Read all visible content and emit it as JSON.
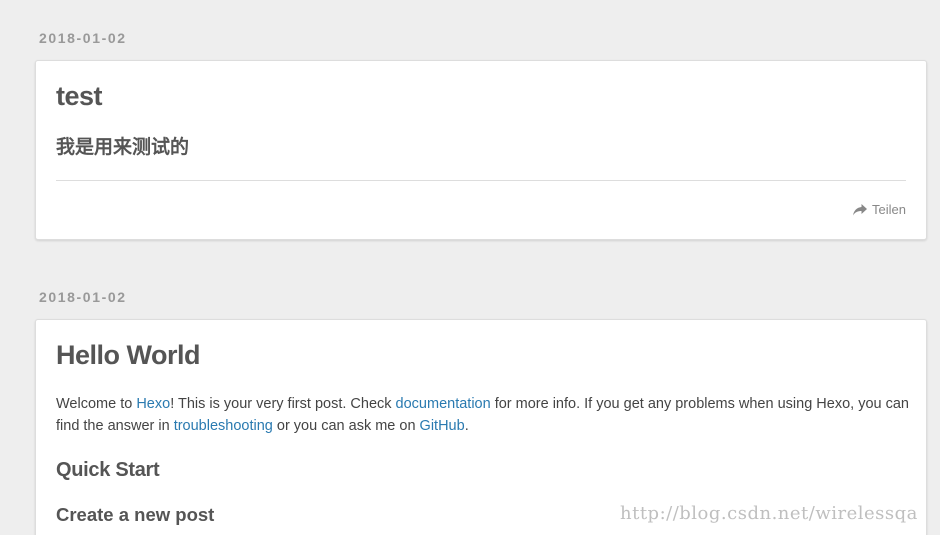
{
  "posts": [
    {
      "date": "2018-01-02",
      "title": "test",
      "subtitle": "我是用来测试的",
      "share_label": "Teilen"
    },
    {
      "date": "2018-01-02",
      "title": "Hello World",
      "body": {
        "t1": "Welcome to ",
        "link_hexo": "Hexo",
        "t2": "! This is your very first post. Check ",
        "link_docs": "documentation",
        "t3": " for more info. If you get any problems when using Hexo, you can find the answer in ",
        "link_trouble": "troubleshooting",
        "t4": " or you can ask me on ",
        "link_github": "GitHub",
        "t5": "."
      },
      "h2": "Quick Start",
      "h3": "Create a new post"
    }
  ],
  "watermark": "http://blog.csdn.net/wirelessqa",
  "colors": {
    "background": "#eeeeee",
    "card": "#ffffff",
    "link": "#2a7ab0",
    "date": "#999999",
    "text": "#555555"
  },
  "icons": {
    "share": "share-arrow-icon"
  }
}
